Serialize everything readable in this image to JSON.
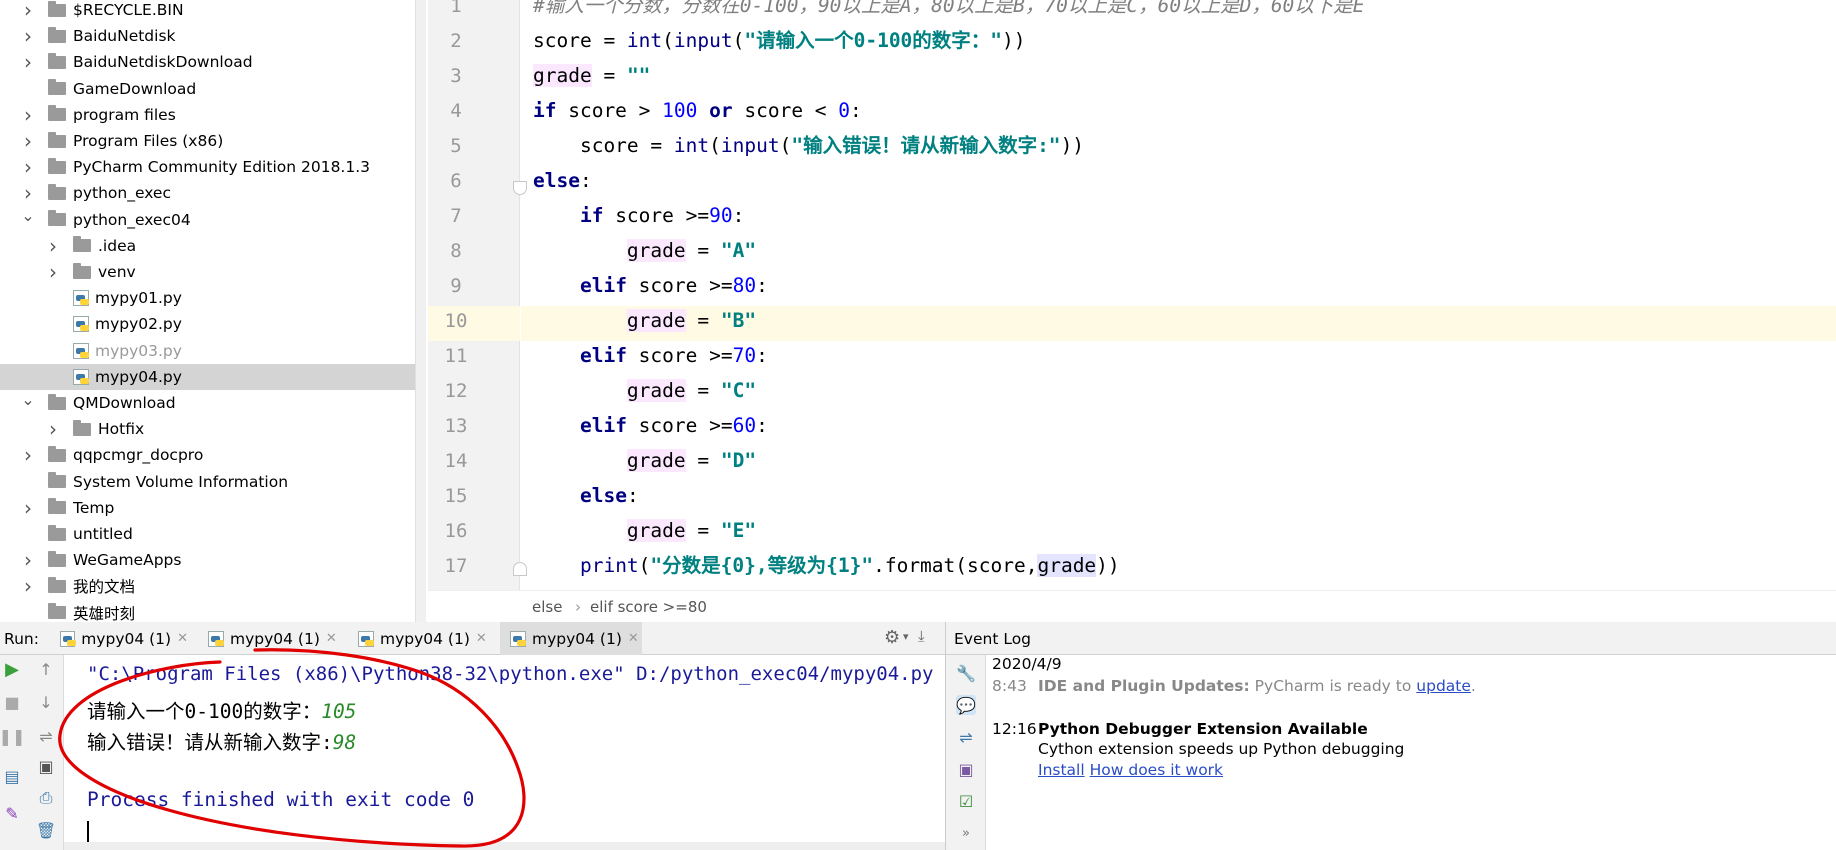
{
  "project_tree": {
    "items": [
      {
        "label": "$RECYCLE.BIN",
        "expanded": false,
        "type": "folder"
      },
      {
        "label": "BaiduNetdisk",
        "expanded": false,
        "type": "folder"
      },
      {
        "label": "BaiduNetdiskDownload",
        "expanded": false,
        "type": "folder"
      },
      {
        "label": "GameDownload",
        "expanded": null,
        "type": "folder"
      },
      {
        "label": "program files",
        "expanded": false,
        "type": "folder"
      },
      {
        "label": "Program Files (x86)",
        "expanded": false,
        "type": "folder"
      },
      {
        "label": "PyCharm Community Edition 2018.1.3",
        "expanded": false,
        "type": "folder"
      },
      {
        "label": "python_exec",
        "expanded": false,
        "type": "folder"
      },
      {
        "label": "python_exec04",
        "expanded": true,
        "type": "folder"
      },
      {
        "label": ".idea",
        "expanded": false,
        "type": "folder"
      },
      {
        "label": "venv",
        "expanded": false,
        "type": "folder"
      },
      {
        "label": "mypy01.py",
        "type": "python"
      },
      {
        "label": "mypy02.py",
        "type": "python"
      },
      {
        "label": "mypy03.py",
        "type": "python",
        "dimmed": true
      },
      {
        "label": "mypy04.py",
        "type": "python",
        "selected": true
      },
      {
        "label": "QMDownload",
        "expanded": true,
        "type": "folder"
      },
      {
        "label": "Hotfix",
        "expanded": false,
        "type": "folder"
      },
      {
        "label": "qqpcmgr_docpro",
        "expanded": false,
        "type": "folder"
      },
      {
        "label": "System Volume Information",
        "expanded": null,
        "type": "folder"
      },
      {
        "label": "Temp",
        "expanded": false,
        "type": "folder"
      },
      {
        "label": "untitled",
        "expanded": null,
        "type": "folder"
      },
      {
        "label": "WeGameApps",
        "expanded": false,
        "type": "folder"
      },
      {
        "label": "我的文档",
        "expanded": false,
        "type": "folder"
      },
      {
        "label": "英雄时刻",
        "expanded": null,
        "type": "folder"
      }
    ]
  },
  "editor": {
    "line_numbers": [
      "1",
      "2",
      "3",
      "4",
      "5",
      "6",
      "7",
      "8",
      "9",
      "10",
      "11",
      "12",
      "13",
      "14",
      "15",
      "16",
      "17"
    ],
    "current_line": 10,
    "lines": {
      "l1": "#输入一个分数，分数在0-100，90以上是A，80以上是B，70以上是C，60以上是D，60以下是E",
      "l2_a": "score = ",
      "l2_b": "int",
      "l2_c": "(",
      "l2_d": "input",
      "l2_e": "(",
      "l2_f": "\"请输入一个0-100的数字：\"",
      "l2_g": "))",
      "l3_a": "grade",
      "l3_b": " = ",
      "l3_c": "\"\"",
      "l4_a": "if",
      "l4_b": " score > ",
      "l4_c": "100",
      "l4_d": " ",
      "l4_e": "or",
      "l4_f": " score < ",
      "l4_g": "0",
      "l4_h": ":",
      "l5_a": "    score = ",
      "l5_b": "int",
      "l5_c": "(",
      "l5_d": "input",
      "l5_e": "(",
      "l5_f": "\"输入错误！请从新输入数字:\"",
      "l5_g": "))",
      "l6_a": "else",
      "l6_b": ":",
      "l7_a": "    ",
      "l7_b": "if",
      "l7_c": " score >=",
      "l7_d": "90",
      "l7_e": ":",
      "l8_a": "        ",
      "l8_b": "grade",
      "l8_c": " = ",
      "l8_d": "\"A\"",
      "l9_a": "    ",
      "l9_b": "elif",
      "l9_c": " score >=",
      "l9_d": "80",
      "l9_e": ":",
      "l10_a": "        ",
      "l10_b": "grade",
      "l10_c": " = ",
      "l10_d": "\"B\"",
      "l11_a": "    ",
      "l11_b": "elif",
      "l11_c": " score >=",
      "l11_d": "70",
      "l11_e": ":",
      "l12_a": "        ",
      "l12_b": "grade",
      "l12_c": " = ",
      "l12_d": "\"C\"",
      "l13_a": "    ",
      "l13_b": "elif",
      "l13_c": " score >=",
      "l13_d": "60",
      "l13_e": ":",
      "l14_a": "        ",
      "l14_b": "grade",
      "l14_c": " = ",
      "l14_d": "\"D\"",
      "l15_a": "    ",
      "l15_b": "else",
      "l15_c": ":",
      "l16_a": "        ",
      "l16_b": "grade",
      "l16_c": " = ",
      "l16_d": "\"E\"",
      "l17_a": "    ",
      "l17_b": "print",
      "l17_c": "(",
      "l17_d": "\"分数是{0},等级为{1}\"",
      "l17_e": ".format(score,",
      "l17_f": "grade",
      "l17_g": "))"
    },
    "breadcrumb": {
      "part1": "else",
      "sep": "›",
      "part2": "elif score >=80"
    }
  },
  "run_panel": {
    "label": "Run:",
    "tabs": [
      {
        "label": "mypy04 (1)",
        "active": false
      },
      {
        "label": "mypy04 (1)",
        "active": false
      },
      {
        "label": "mypy04 (1)",
        "active": false
      },
      {
        "label": "mypy04 (1)",
        "active": true
      }
    ],
    "console": {
      "command": "\"C:\\Program Files (x86)\\Python38-32\\python.exe\" D:/python_exec04/mypy04.py",
      "prompt1": "请输入一个0-100的数字：",
      "input1": "105",
      "prompt2": "输入错误！请从新输入数字:",
      "input2": "98",
      "finished": "Process finished with exit code 0"
    }
  },
  "event_log": {
    "title": "Event Log",
    "date": "2020/4/9",
    "entries": [
      {
        "time": "8:43",
        "title": "IDE and Plugin Updates:",
        "text": "PyCharm is ready to",
        "link": "update",
        "suffix": "."
      },
      {
        "time": "12:16",
        "title": "Python Debugger Extension Available",
        "text": "Cython extension speeds up Python debugging",
        "link1": "Install",
        "link2": "How does it work"
      }
    ]
  },
  "colors": {
    "keyword": "#000080",
    "number": "#0000ff",
    "string": "#008080",
    "comment": "#808080",
    "console_command": "#1a1a99",
    "console_input": "#2a8a2a",
    "annotation": "#e00000",
    "link": "#2a4cc6",
    "current_line": "#fffae3"
  },
  "icons": [
    "folder-icon",
    "python-file-icon",
    "chevron-right-icon",
    "chevron-down-icon",
    "run-icon",
    "stop-icon",
    "pause-icon",
    "gear-icon",
    "pin-icon",
    "trash-icon",
    "wrench-icon",
    "chat-icon",
    "close-icon"
  ]
}
